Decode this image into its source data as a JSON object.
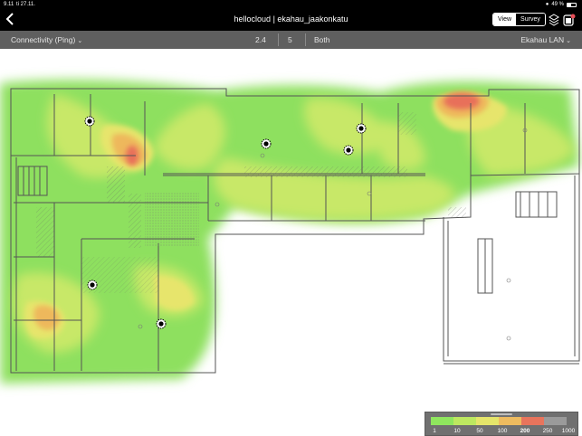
{
  "status": {
    "time": "9.11",
    "date": "ti 27.11.",
    "battery": "49 %"
  },
  "nav": {
    "title": "hellocloud | ekahau_jaakonkatu",
    "back_icon": "chevron-left-icon",
    "modes": [
      "View",
      "Survey"
    ],
    "active_mode": "View"
  },
  "toolbar": {
    "visualization": "Connectivity (Ping)",
    "band_24": "2.4",
    "band_5": "5",
    "band_both": "Both",
    "network": "Ekahau LAN"
  },
  "legend": {
    "ticks": [
      "1",
      "10",
      "50",
      "100",
      "200",
      "250",
      "1000"
    ],
    "selected_tick": "200",
    "colors": [
      "#8fe65e",
      "#bde860",
      "#e5e56a",
      "#eebb5f",
      "#e8745c",
      "#9a9a9a"
    ]
  },
  "colors": {
    "green": "#8ee05e",
    "yellow_green": "#c8e868",
    "yellow": "#e7e56c",
    "orange": "#eeb85c",
    "red": "#e8705a"
  }
}
